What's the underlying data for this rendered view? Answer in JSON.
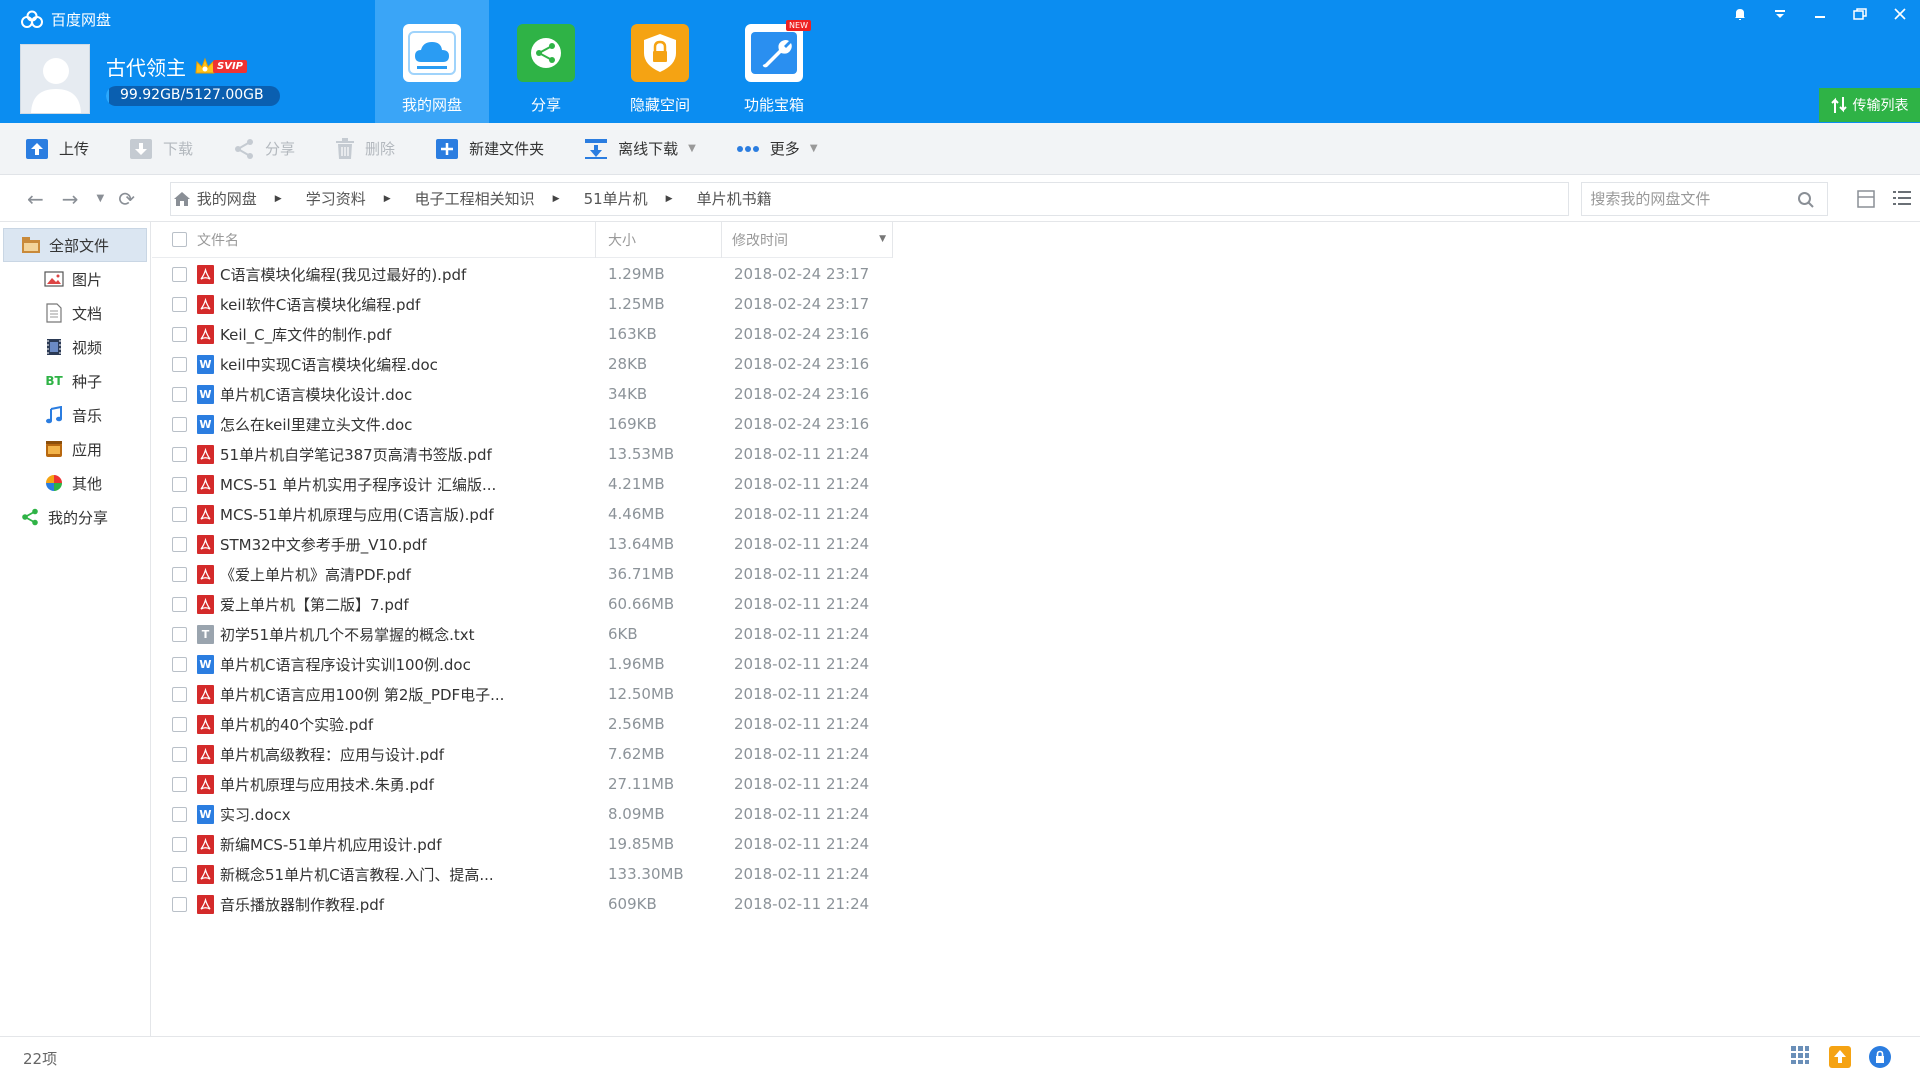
{
  "app": {
    "title": "百度网盘",
    "username": "古代领主",
    "vip_badge": "SVIP",
    "quota_text": "99.92GB/5127.00GB",
    "quota_used_fraction": 0.0195
  },
  "nav_tabs": [
    {
      "label": "我的网盘",
      "icon": "cloud-drive-icon",
      "active": true
    },
    {
      "label": "分享",
      "icon": "share-icon"
    },
    {
      "label": "隐藏空间",
      "icon": "lock-icon"
    },
    {
      "label": "功能宝箱",
      "icon": "toolbox-icon",
      "badge": "NEW"
    }
  ],
  "transfer_list_label": "传输列表",
  "toolbar": {
    "upload": "上传",
    "download": "下载",
    "share": "分享",
    "delete": "删除",
    "new_folder": "新建文件夹",
    "offline_download": "离线下载",
    "more": "更多"
  },
  "breadcrumb": [
    "我的网盘",
    "学习资料",
    "电子工程相关知识",
    "51单片机",
    "单片机书籍"
  ],
  "search": {
    "placeholder": "搜索我的网盘文件"
  },
  "sidebar": {
    "all_files": "全部文件",
    "items": [
      "图片",
      "文档",
      "视频",
      "种子",
      "音乐",
      "应用",
      "其他"
    ],
    "bt_label": "BT",
    "my_share": "我的分享"
  },
  "columns": {
    "name": "文件名",
    "size": "大小",
    "modified": "修改时间"
  },
  "files": [
    {
      "name": "C语言模块化编程(我见过最好的).pdf",
      "type": "pdf",
      "size": "1.29MB",
      "modified": "2018-02-24 23:17"
    },
    {
      "name": "keil软件C语言模块化编程.pdf",
      "type": "pdf",
      "size": "1.25MB",
      "modified": "2018-02-24 23:17"
    },
    {
      "name": "Keil_C_库文件的制作.pdf",
      "type": "pdf",
      "size": "163KB",
      "modified": "2018-02-24 23:16"
    },
    {
      "name": "keil中实现C语言模块化编程.doc",
      "type": "doc",
      "size": "28KB",
      "modified": "2018-02-24 23:16"
    },
    {
      "name": "单片机C语言模块化设计.doc",
      "type": "doc",
      "size": "34KB",
      "modified": "2018-02-24 23:16"
    },
    {
      "name": "怎么在keil里建立头文件.doc",
      "type": "doc",
      "size": "169KB",
      "modified": "2018-02-24 23:16"
    },
    {
      "name": "51单片机自学笔记387页高清书签版.pdf",
      "type": "pdf",
      "size": "13.53MB",
      "modified": "2018-02-11 21:24"
    },
    {
      "name": "MCS-51 单片机实用子程序设计 汇编版...",
      "type": "pdf",
      "size": "4.21MB",
      "modified": "2018-02-11 21:24"
    },
    {
      "name": "MCS-51单片机原理与应用(C语言版).pdf",
      "type": "pdf",
      "size": "4.46MB",
      "modified": "2018-02-11 21:24"
    },
    {
      "name": "STM32中文参考手册_V10.pdf",
      "type": "pdf",
      "size": "13.64MB",
      "modified": "2018-02-11 21:24"
    },
    {
      "name": "《爱上单片机》高清PDF.pdf",
      "type": "pdf",
      "size": "36.71MB",
      "modified": "2018-02-11 21:24"
    },
    {
      "name": "爱上单片机【第二版】7.pdf",
      "type": "pdf",
      "size": "60.66MB",
      "modified": "2018-02-11 21:24"
    },
    {
      "name": "初学51单片机几个不易掌握的概念.txt",
      "type": "txt",
      "size": "6KB",
      "modified": "2018-02-11 21:24"
    },
    {
      "name": "单片机C语言程序设计实训100例.doc",
      "type": "doc",
      "size": "1.96MB",
      "modified": "2018-02-11 21:24"
    },
    {
      "name": "单片机C语言应用100例  第2版_PDF电子...",
      "type": "pdf",
      "size": "12.50MB",
      "modified": "2018-02-11 21:24"
    },
    {
      "name": "单片机的40个实验.pdf",
      "type": "pdf",
      "size": "2.56MB",
      "modified": "2018-02-11 21:24"
    },
    {
      "name": "单片机高级教程：应用与设计.pdf",
      "type": "pdf",
      "size": "7.62MB",
      "modified": "2018-02-11 21:24"
    },
    {
      "name": "单片机原理与应用技术.朱勇.pdf",
      "type": "pdf",
      "size": "27.11MB",
      "modified": "2018-02-11 21:24"
    },
    {
      "name": "实习.docx",
      "type": "doc",
      "size": "8.09MB",
      "modified": "2018-02-11 21:24"
    },
    {
      "name": "新编MCS-51单片机应用设计.pdf",
      "type": "pdf",
      "size": "19.85MB",
      "modified": "2018-02-11 21:24"
    },
    {
      "name": "新概念51单片机C语言教程.入门、提高...",
      "type": "pdf",
      "size": "133.30MB",
      "modified": "2018-02-11 21:24"
    },
    {
      "name": "音乐播放器制作教程.pdf",
      "type": "pdf",
      "size": "609KB",
      "modified": "2018-02-11 21:24"
    }
  ],
  "status": {
    "item_count": "22项"
  },
  "file_type_glyphs": {
    "doc": "W",
    "txt": "T"
  },
  "colors": {
    "header": "#0b8df1",
    "active_tab": "#3aa5f7",
    "transfer": "#2fb346",
    "pdf": "#d42a2a",
    "doc": "#2b7de0"
  }
}
